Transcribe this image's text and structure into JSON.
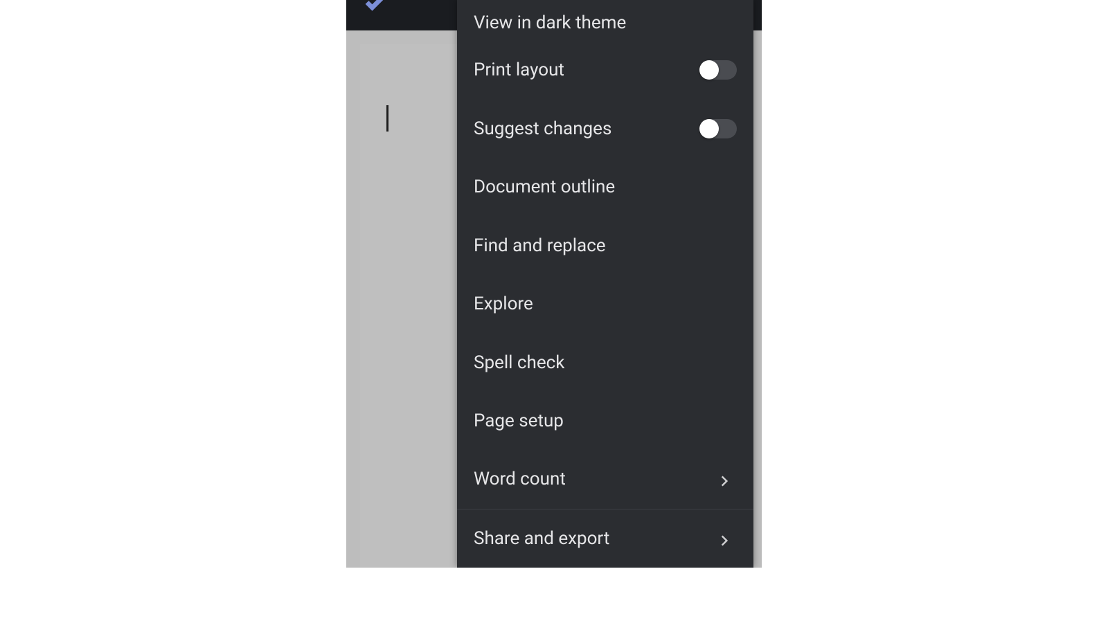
{
  "menu": {
    "items": [
      {
        "label": "View in dark theme",
        "type": "plain"
      },
      {
        "label": "Print layout",
        "type": "toggle"
      },
      {
        "label": "Suggest changes",
        "type": "toggle"
      },
      {
        "label": "Document outline",
        "type": "plain"
      },
      {
        "label": "Find and replace",
        "type": "plain"
      },
      {
        "label": "Explore",
        "type": "plain"
      },
      {
        "label": "Spell check",
        "type": "plain"
      },
      {
        "label": "Page setup",
        "type": "plain"
      },
      {
        "label": "Word count",
        "type": "submenu"
      },
      {
        "label": "Share and export",
        "type": "submenu"
      }
    ]
  }
}
